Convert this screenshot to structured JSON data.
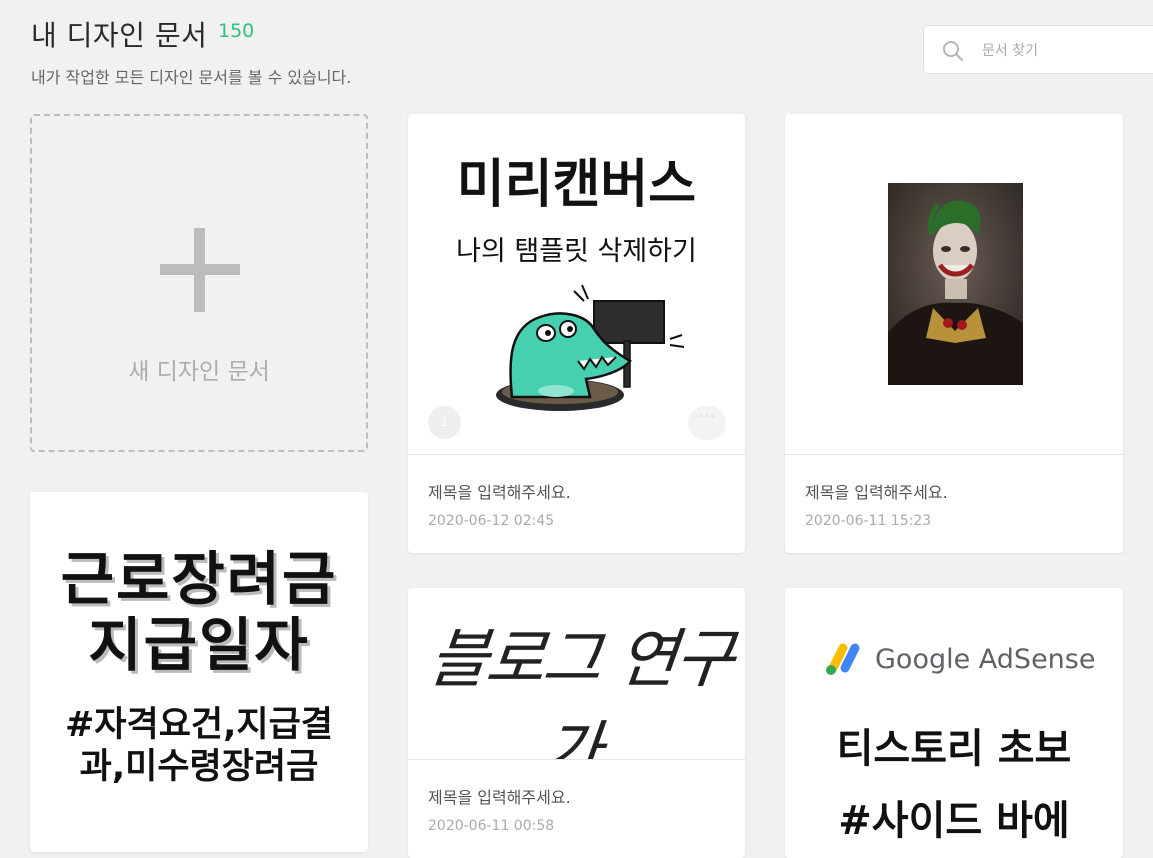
{
  "header": {
    "title": "내 디자인 문서",
    "count": "150",
    "subtitle": "내가 작업한 모든 디자인 문서를 볼 수 있습니다."
  },
  "search": {
    "placeholder": "문서 찾기",
    "value": ""
  },
  "new_card": {
    "label": "새 디자인 문서",
    "icon": "plus-icon"
  },
  "cards": [
    {
      "thumbnail_lines": [
        "미리캔버스",
        "나의 탬플릿 삭제하기"
      ],
      "page_badge": "1",
      "more": "···",
      "title": "제목을 입력해주세요.",
      "date": "2020-06-12 02:45"
    },
    {
      "title": "제목을 입력해주세요.",
      "date": "2020-06-11 15:23"
    },
    {
      "thumbnail_lines": [
        "근로장려금",
        "지급일자",
        "#자격요건,지급결",
        "과,미수령장려금"
      ]
    },
    {
      "thumbnail_lines": [
        "블로그 연구가"
      ],
      "title": "제목을 입력해주세요.",
      "date": "2020-06-11 00:58"
    },
    {
      "thumbnail_lines": [
        "Google AdSense",
        "티스토리 초보",
        "#사이드 바에"
      ]
    }
  ],
  "colors": {
    "accent": "#2ec27e",
    "background": "#f1f1f1"
  }
}
